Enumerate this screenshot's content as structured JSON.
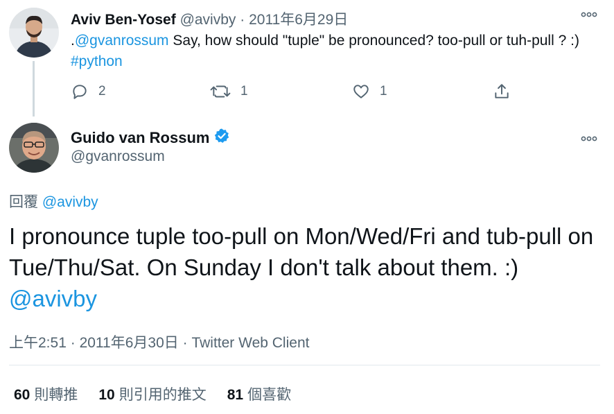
{
  "parent_tweet": {
    "display_name": "Aviv Ben-Yosef",
    "handle": "@avivby",
    "separator": "·",
    "date": "2011年6月29日",
    "more_icon": "more-dots-icon",
    "text_prefix": ".",
    "mention": "@gvanrossum",
    "text_body": " Say, how should \"tuple\" be pronounced? too-pull or tuh-pull ? :) ",
    "hashtag": "#python",
    "reply_count": "2",
    "retweet_count": "1",
    "like_count": "1"
  },
  "main_tweet": {
    "display_name": "Guido van Rossum",
    "handle": "@gvanrossum",
    "verified": true,
    "reply_label": "回覆",
    "reply_to": "@avivby",
    "text": "I pronounce tuple too-pull on Mon/Wed/Fri and tub-pull on Tue/Thu/Sat. On Sunday I don't talk about them. :) ",
    "text_mention": "@avivby",
    "time": "上午2:51",
    "meta_separator": "·",
    "date": "2011年6月30日",
    "source_separator": "·",
    "source": "Twitter Web Client"
  },
  "stats": {
    "retweets_num": "60",
    "retweets_label": "則轉推",
    "quotes_num": "10",
    "quotes_label": "則引用的推文",
    "likes_num": "81",
    "likes_label": "個喜歡"
  },
  "colors": {
    "link": "#1b95e0",
    "secondary": "#536471",
    "verified": "#1d9bf0",
    "divider": "#e1e8ed"
  }
}
